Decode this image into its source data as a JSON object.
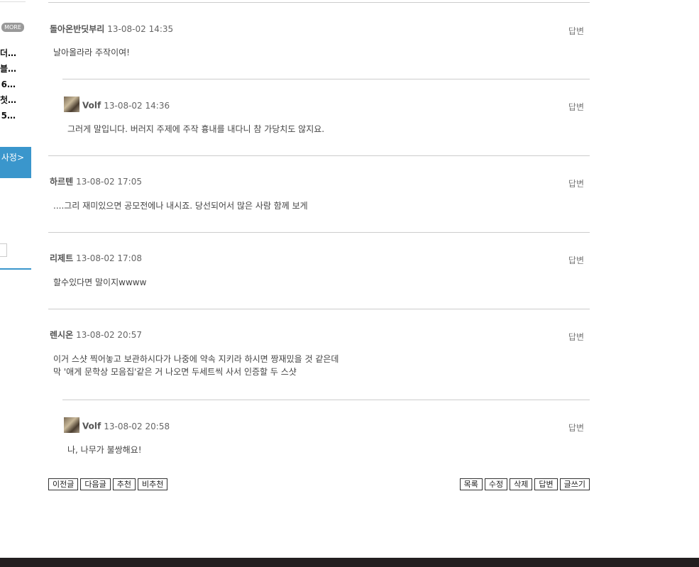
{
  "sidebar": {
    "more_label": "MORE",
    "items": [
      "더…",
      "블…",
      "6…",
      "첫…",
      "5…"
    ],
    "banner_text": "사정>"
  },
  "comments": [
    {
      "author": "돌아온반딧부리",
      "date": "13-08-02 14:35",
      "body": [
        "날아올라라 주작이여!"
      ],
      "reply": "답변",
      "is_reply": false
    },
    {
      "author": "Volf",
      "date": "13-08-02 14:36",
      "body": [
        "그러게 말입니다. 버러지 주제에 주작 흉내를 내다니 참 가당치도 않지요."
      ],
      "reply": "답변",
      "is_reply": true
    },
    {
      "author": "하르텐",
      "date": "13-08-02 17:05",
      "body": [
        "....그리 재미있으면 공모전에나 내시죠. 당선되어서 많은 사람 함께 보게"
      ],
      "reply": "답변",
      "is_reply": false
    },
    {
      "author": "리제트",
      "date": "13-08-02 17:08",
      "body": [
        "할수있다면 말이지wwww"
      ],
      "reply": "답변",
      "is_reply": false
    },
    {
      "author": "렌시온",
      "date": "13-08-02 20:57",
      "body": [
        "이거 스샷 찍어놓고 보관하시다가 나중에 약속 지키라 하시면 짱재밌을 것 같은데",
        "막 '애게 문학상 모음집'같은 거 나오면 두세트씩 사서 인증할 두 스샷"
      ],
      "reply": "답변",
      "is_reply": false
    },
    {
      "author": "Volf",
      "date": "13-08-02 20:58",
      "body": [
        "나, 나무가 불쌍해요!"
      ],
      "reply": "답변",
      "is_reply": true
    }
  ],
  "buttons_left": [
    "이전글",
    "다음글",
    "추천",
    "비추천"
  ],
  "buttons_right": [
    "목록",
    "수정",
    "삭제",
    "답변",
    "글쓰기"
  ],
  "colors": {
    "accent": "#3a96cc",
    "footer": "#231f20",
    "rule": "#cccccc"
  }
}
